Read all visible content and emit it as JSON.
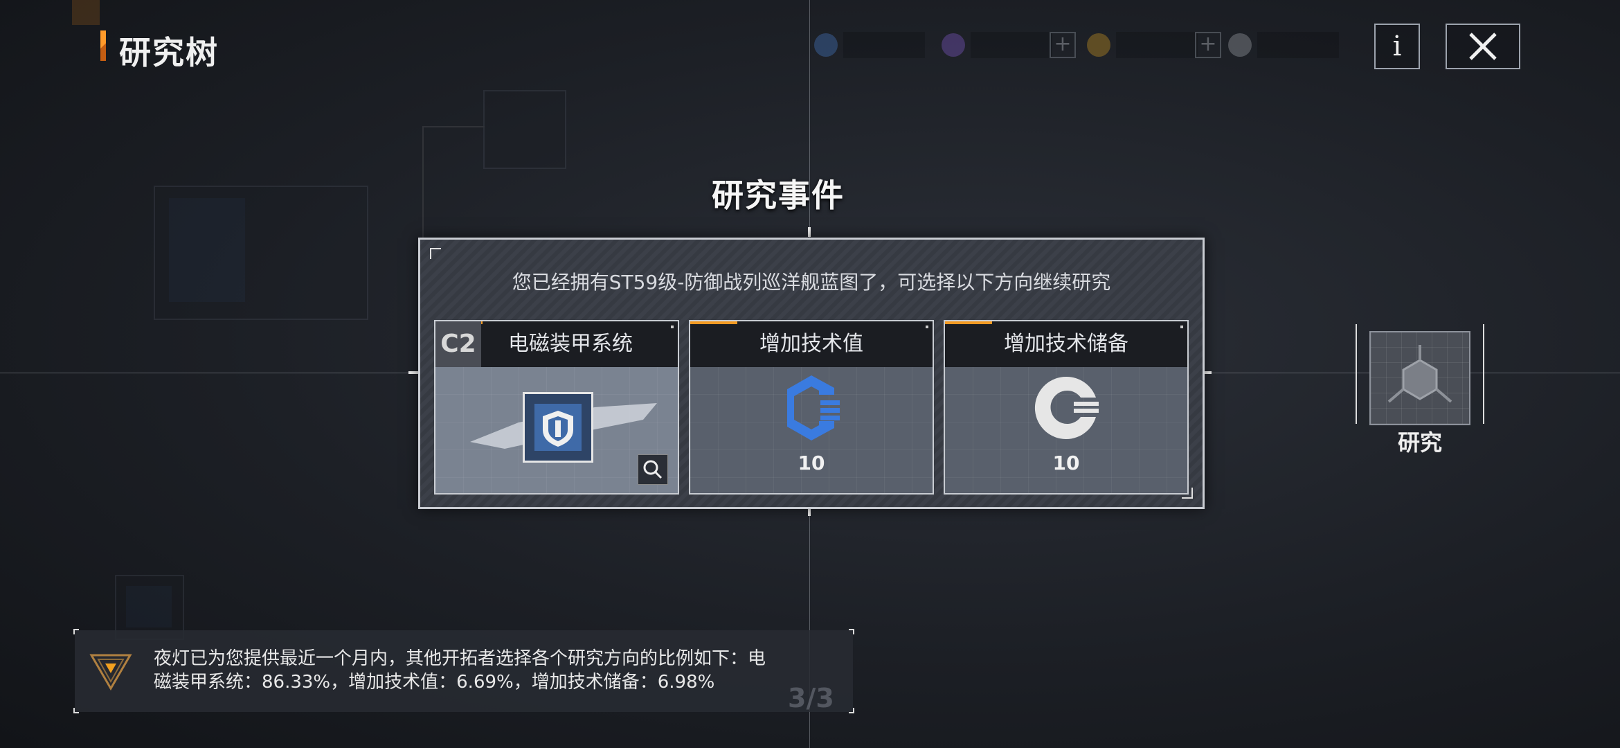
{
  "header": {
    "title": "研究树",
    "resources": [
      {
        "name": "blue-coin",
        "value": "",
        "color": "#4a7fd0"
      },
      {
        "name": "purple-gem",
        "value": "",
        "color": "#8a5fd6"
      },
      {
        "name": "gold-gem",
        "value": "",
        "color": "#d9a023"
      },
      {
        "name": "gray-token",
        "value": "",
        "color": "#a8acb3"
      }
    ],
    "plus_label": "+",
    "info_label": "i"
  },
  "event": {
    "title": "研究事件",
    "description": "您已经拥有ST59级-防御战列巡洋舰蓝图了，可选择以下方向继续研究",
    "options": [
      {
        "tag": "C2",
        "label": "电磁装甲系统",
        "amount": ""
      },
      {
        "label": "增加技术值",
        "amount": "10",
        "icon": "tech-value-icon",
        "color": "#3a7be0"
      },
      {
        "label": "增加技术储备",
        "amount": "10",
        "icon": "tech-reserve-icon",
        "color": "#e6e6e6"
      }
    ]
  },
  "side": {
    "label": "研究"
  },
  "tip": {
    "text": "夜灯已为您提供最近一个月内，其他开拓者选择各个研究方向的比例如下：电磁装甲系统：86.33%，增加技术值：6.69%，增加技术储备：6.98%",
    "page": "3/3"
  }
}
